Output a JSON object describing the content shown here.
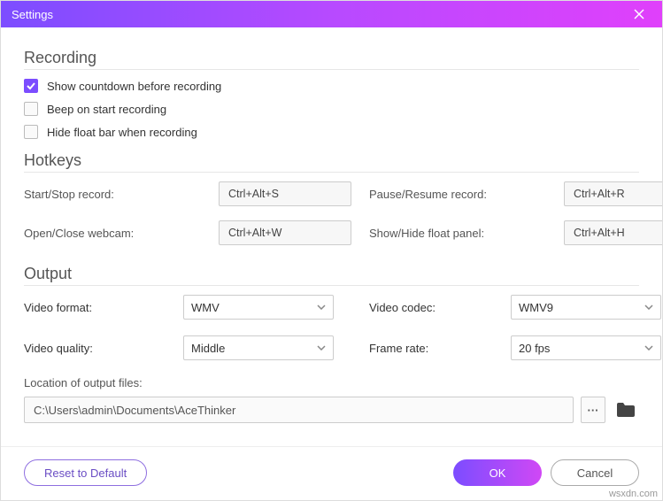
{
  "window": {
    "title": "Settings"
  },
  "sections": {
    "recording": {
      "title": "Recording"
    },
    "hotkeys": {
      "title": "Hotkeys"
    },
    "output": {
      "title": "Output"
    }
  },
  "recording": {
    "countdown": {
      "label": "Show countdown before recording",
      "checked": true
    },
    "beep": {
      "label": "Beep on start recording",
      "checked": false
    },
    "hideFloat": {
      "label": "Hide float bar when recording",
      "checked": false
    }
  },
  "hotkeys": {
    "startStop": {
      "label": "Start/Stop record:",
      "value": "Ctrl+Alt+S"
    },
    "pauseResume": {
      "label": "Pause/Resume record:",
      "value": "Ctrl+Alt+R"
    },
    "webcam": {
      "label": "Open/Close webcam:",
      "value": "Ctrl+Alt+W"
    },
    "floatPanel": {
      "label": "Show/Hide float panel:",
      "value": "Ctrl+Alt+H"
    }
  },
  "output": {
    "videoFormat": {
      "label": "Video format:",
      "value": "WMV"
    },
    "videoCodec": {
      "label": "Video codec:",
      "value": "WMV9"
    },
    "videoQuality": {
      "label": "Video quality:",
      "value": "Middle"
    },
    "frameRate": {
      "label": "Frame rate:",
      "value": "20 fps"
    },
    "locationLabel": "Location of output files:",
    "locationValue": "C:\\Users\\admin\\Documents\\AceThinker",
    "more": "···"
  },
  "buttons": {
    "reset": "Reset to Default",
    "ok": "OK",
    "cancel": "Cancel"
  },
  "watermark": "wsxdn.com"
}
